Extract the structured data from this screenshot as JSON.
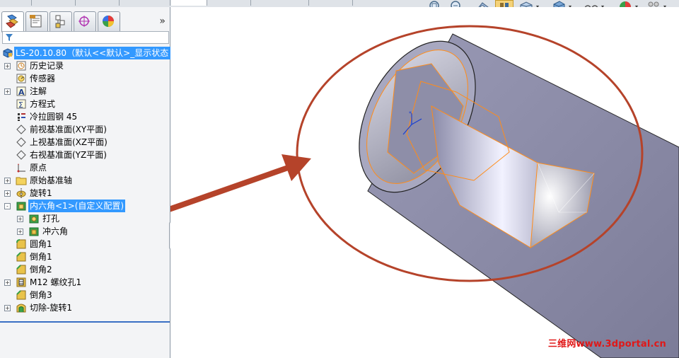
{
  "window": {
    "collapse_glyph": "»"
  },
  "toolbar": {
    "view_tools": [
      "zoom-to-fit-icon",
      "zoom-area-icon",
      "previous-view-icon",
      "section-view-icon",
      "view-orientation-icon",
      "display-style-icon",
      "hide-show-items-icon",
      "edit-appearance-icon",
      "apply-scene-icon"
    ],
    "tabs": [
      "feature-manager-tab",
      "property-manager-tab",
      "configuration-manager-tab",
      "dimxpert-manager-tab",
      "display-manager-tab"
    ]
  },
  "tree": {
    "root_label": "LS-20.10.80（默认<<默认>_显示状态 1",
    "items": [
      {
        "label": "历史记录",
        "icon": "history-icon",
        "expand": "+"
      },
      {
        "label": "传感器",
        "icon": "sensor-icon",
        "expand": ""
      },
      {
        "label": "注解",
        "icon": "annotation-icon",
        "expand": "+"
      },
      {
        "label": "方程式",
        "icon": "equation-icon",
        "expand": ""
      },
      {
        "label": "冷拉圆钢 45",
        "icon": "material-icon",
        "expand": ""
      },
      {
        "label": "前视基准面(XY平面)",
        "icon": "plane-icon",
        "expand": ""
      },
      {
        "label": "上视基准面(XZ平面)",
        "icon": "plane-icon",
        "expand": ""
      },
      {
        "label": "右视基准面(YZ平面)",
        "icon": "plane-icon",
        "expand": ""
      },
      {
        "label": "原点",
        "icon": "origin-icon",
        "expand": ""
      },
      {
        "label": "原始基准轴",
        "icon": "folder-icon",
        "expand": "+"
      },
      {
        "label": "旋转1",
        "icon": "revolve-icon",
        "expand": "+"
      },
      {
        "label": "内六角<1>(自定义配置)",
        "icon": "library-feature-icon",
        "expand": "-",
        "selected": true
      },
      {
        "label": "打孔",
        "icon": "hole-feature-icon",
        "expand": "+",
        "child": true
      },
      {
        "label": "冲六角",
        "icon": "cut-feature-icon",
        "expand": "+",
        "child": true
      },
      {
        "label": "圆角1",
        "icon": "fillet-icon",
        "expand": ""
      },
      {
        "label": "倒角1",
        "icon": "chamfer-icon",
        "expand": ""
      },
      {
        "label": "倒角2",
        "icon": "chamfer-icon",
        "expand": ""
      },
      {
        "label": "M12 螺纹孔1",
        "icon": "hole-wizard-icon",
        "expand": "+"
      },
      {
        "label": "倒角3",
        "icon": "chamfer-icon",
        "expand": ""
      },
      {
        "label": "切除-旋转1",
        "icon": "cut-revolve-icon",
        "expand": "+"
      }
    ]
  },
  "viewport": {
    "watermark": "三维网www.3dportal.cn"
  },
  "colors": {
    "selection": "#3399ff",
    "annotation_red": "#b5432a",
    "edge_highlight": "#ff8c1a",
    "part_body": "#8a8aa6"
  }
}
